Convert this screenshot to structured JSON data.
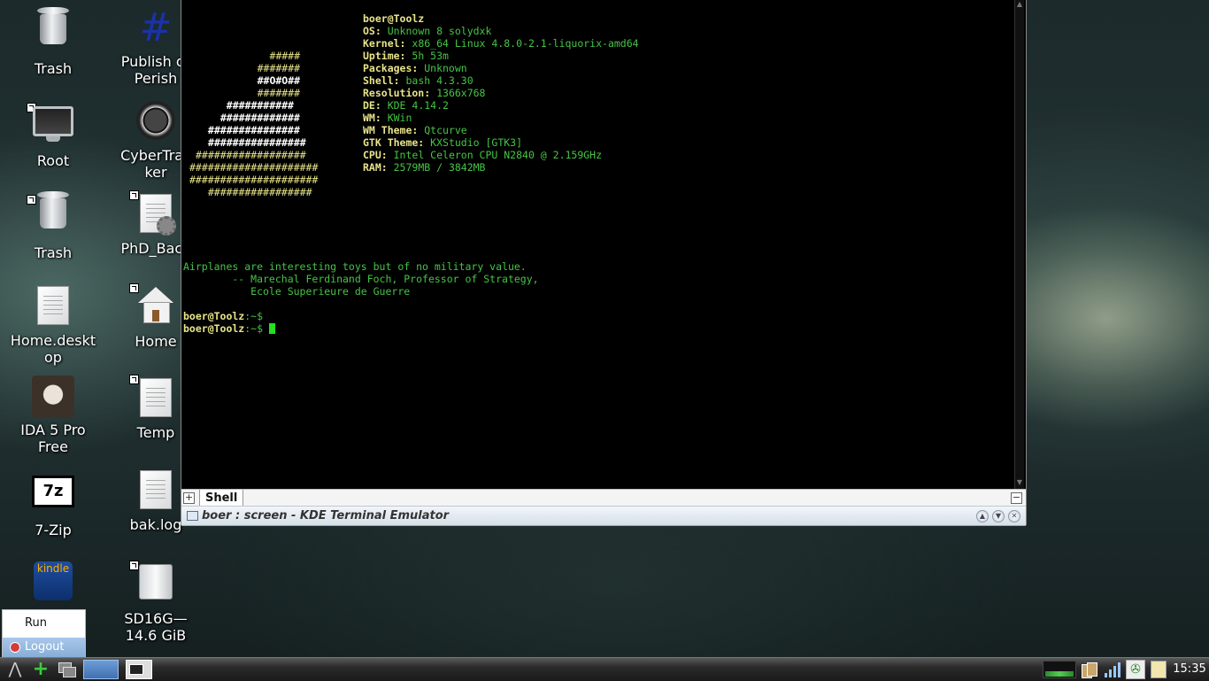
{
  "desktop": {
    "icons_left": [
      {
        "name": "trash-icon",
        "label": "Trash"
      },
      {
        "name": "monitor-icon",
        "label": "Root"
      },
      {
        "name": "trash-icon",
        "label": "Trash"
      },
      {
        "name": "document-icon",
        "label": "Home.desktop"
      },
      {
        "name": "avatar-icon",
        "label": "IDA 5 Pro Free"
      },
      {
        "name": "7zip-icon",
        "label": "7-Zip",
        "logo": "7z"
      },
      {
        "name": "kindle-icon",
        "label": "",
        "logo": "kindle"
      }
    ],
    "icons_right": [
      {
        "name": "publish-or-perish-icon",
        "label": "Publish or Perish"
      },
      {
        "name": "cybertracker-icon",
        "label": "CyberTracker"
      },
      {
        "name": "settings-document-icon",
        "label": "PhD_Back"
      },
      {
        "name": "home-icon",
        "label": "Home"
      },
      {
        "name": "document-icon",
        "label": "Temp"
      },
      {
        "name": "document-icon",
        "label": "bak.log"
      },
      {
        "name": "drive-icon",
        "label": "SD16G— 14.6 GiB"
      }
    ]
  },
  "terminal": {
    "user_host": "boer@Toolz",
    "sysinfo": [
      {
        "key": "OS:",
        "value": " Unknown 8 solydxk"
      },
      {
        "key": "Kernel:",
        "value": " x86_64 Linux 4.8.0-2.1-liquorix-amd64"
      },
      {
        "key": "Uptime:",
        "value": " 5h 53m"
      },
      {
        "key": "Packages:",
        "value": " Unknown"
      },
      {
        "key": "Shell:",
        "value": " bash 4.3.30"
      },
      {
        "key": "Resolution:",
        "value": " 1366x768"
      },
      {
        "key": "DE:",
        "value": " KDE 4.14.2"
      },
      {
        "key": "WM:",
        "value": " KWin"
      },
      {
        "key": "WM Theme:",
        "value": " Qtcurve"
      },
      {
        "key": "GTK Theme:",
        "value": " KXStudio [GTK3]"
      },
      {
        "key": "CPU:",
        "value": " Intel Celeron CPU N2840 @ 2.159GHz"
      },
      {
        "key": "RAM:",
        "value": " 2579MB / 3842MB"
      }
    ],
    "ascii_logo": [
      "      #####",
      "     #######",
      "     ##O#O##",
      "     #######",
      "   ###########",
      "  #############",
      " ###############",
      " ################",
      "##################",
      "#####################",
      "#####################",
      "  #################"
    ],
    "quote": [
      "Airplanes are interesting toys but of no military value.",
      "        -- Marechal Ferdinand Foch, Professor of Strategy,",
      "           Ecole Superieure de Guerre"
    ],
    "prompt_user": "boer@Toolz",
    "prompt_suffix": ":~$",
    "tab_label": "Shell",
    "window_title": "boer : screen - KDE Terminal Emulator"
  },
  "menu": {
    "run_label": "Run",
    "logout_label": "Logout"
  },
  "taskbar": {
    "clock": "15:35"
  }
}
